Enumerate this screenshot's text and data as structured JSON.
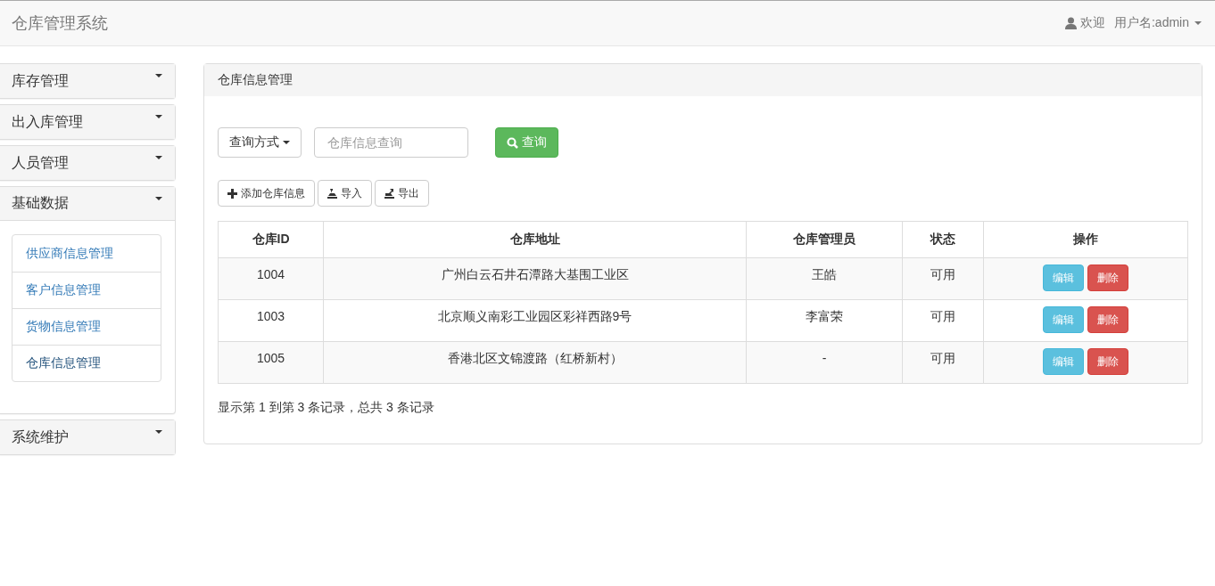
{
  "navbar": {
    "brand": "仓库管理系统",
    "welcome": "欢迎",
    "user": "用户名:admin"
  },
  "sidebar": {
    "panels": [
      {
        "title": "库存管理",
        "expanded": false
      },
      {
        "title": "出入库管理",
        "expanded": false
      },
      {
        "title": "人员管理",
        "expanded": false
      },
      {
        "title": "基础数据",
        "expanded": true,
        "items": [
          {
            "label": "供应商信息管理",
            "selected": false
          },
          {
            "label": "客户信息管理",
            "selected": false
          },
          {
            "label": "货物信息管理",
            "selected": false
          },
          {
            "label": "仓库信息管理",
            "selected": true
          }
        ]
      },
      {
        "title": "系统维护",
        "expanded": false
      }
    ]
  },
  "panel": {
    "title": "仓库信息管理",
    "query": {
      "mode_button": "查询方式",
      "placeholder": "仓库信息查询",
      "search_button": "查询"
    },
    "actions": [
      {
        "kind": "add",
        "label": "添加仓库信息"
      },
      {
        "kind": "import",
        "label": "导入"
      },
      {
        "kind": "export",
        "label": "导出"
      }
    ],
    "table": {
      "columns": [
        "仓库ID",
        "仓库地址",
        "仓库管理员",
        "状态",
        "操作"
      ],
      "rows": [
        {
          "id": "1004",
          "address": "广州白云石井石潭路大基围工业区",
          "manager": "王皓",
          "status": "可用",
          "edit": "编辑",
          "delete": "删除"
        },
        {
          "id": "1003",
          "address": "北京顺义南彩工业园区彩祥西路9号",
          "manager": "李富荣",
          "status": "可用",
          "edit": "编辑",
          "delete": "删除"
        },
        {
          "id": "1005",
          "address": "香港北区文锦渡路（红桥新村）",
          "manager": "-",
          "status": "可用",
          "edit": "编辑",
          "delete": "删除"
        }
      ]
    },
    "footer": "显示第 1 到第 3 条记录，总共 3 条记录"
  }
}
